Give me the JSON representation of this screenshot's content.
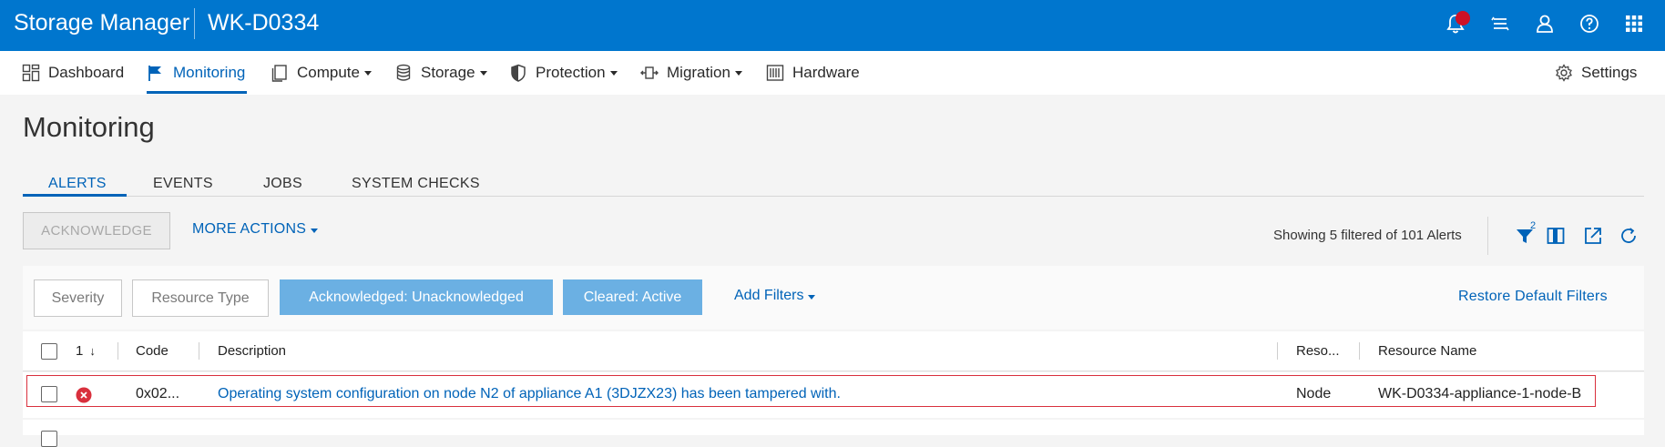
{
  "header": {
    "app_title": "Storage Manager",
    "system_name": "WK-D0334",
    "icons": [
      "bell-icon",
      "tasks-icon",
      "user-icon",
      "help-icon",
      "apps-grid-icon"
    ],
    "notification_color": "#ce1126",
    "brand_color": "#0076ce"
  },
  "nav": {
    "items": [
      {
        "label": "Dashboard",
        "icon": "dashboard-icon"
      },
      {
        "label": "Monitoring",
        "icon": "flag-icon",
        "active": true
      },
      {
        "label": "Compute",
        "icon": "compute-icon",
        "dropdown": true
      },
      {
        "label": "Storage",
        "icon": "database-icon",
        "dropdown": true
      },
      {
        "label": "Protection",
        "icon": "shield-icon",
        "dropdown": true
      },
      {
        "label": "Migration",
        "icon": "migration-icon",
        "dropdown": true
      },
      {
        "label": "Hardware",
        "icon": "hardware-icon"
      }
    ],
    "settings_label": "Settings"
  },
  "page": {
    "title": "Monitoring"
  },
  "tabs": [
    {
      "label": "ALERTS",
      "active": true
    },
    {
      "label": "EVENTS"
    },
    {
      "label": "JOBS"
    },
    {
      "label": "SYSTEM CHECKS"
    }
  ],
  "actions": {
    "acknowledge_label": "ACKNOWLEDGE",
    "more_actions_label": "MORE ACTIONS",
    "showing_text": "Showing 5 filtered of 101 Alerts",
    "filter_count": "2"
  },
  "filters": {
    "severity": "Severity",
    "resource_type": "Resource Type",
    "acknowledged": "Acknowledged: Unacknowledged",
    "cleared": "Cleared: Active",
    "add_filters": "Add Filters",
    "restore": "Restore Default Filters"
  },
  "table": {
    "sort_label": "1",
    "columns": [
      "Code",
      "Description",
      "Reso...",
      "Resource Name"
    ],
    "rows": [
      {
        "severity": "critical",
        "code": "0x02...",
        "description": "Operating system configuration on node N2 of appliance A1 (3DJZX23) has been tampered with.",
        "resource_type": "Node",
        "resource_name": "WK-D0334-appliance-1-node-B"
      }
    ]
  },
  "colors": {
    "accent": "#0063b8",
    "filter_active": "#6bb0e3",
    "critical": "#d9303d"
  }
}
